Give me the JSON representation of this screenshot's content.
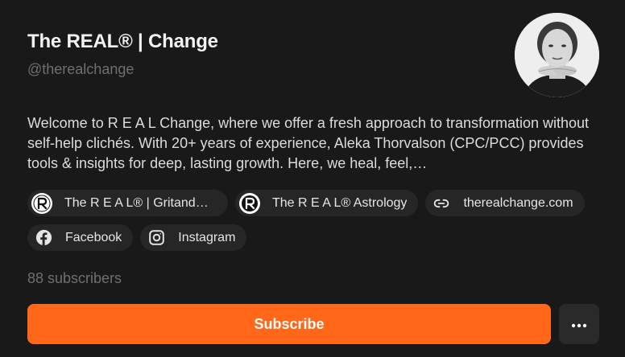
{
  "profile": {
    "title": "The REAL® | Change",
    "handle": "@therealchange",
    "bio": "Welcome to R E A L Change, where we offer a fresh approach to transformation without self-help clichés. With 20+ years of experience, Aleka Thorvalson (CPC/PCC) provides tools & insights for deep, lasting growth. Here, we heal, feel,…"
  },
  "links": [
    {
      "label": "The R E A L® | GritandG…",
      "icon": "real-logo-icon"
    },
    {
      "label": "The R E A L® Astrology",
      "icon": "real-logo-icon"
    },
    {
      "label": "therealchange.com",
      "icon": "link-icon"
    },
    {
      "label": "Facebook",
      "icon": "facebook-icon"
    },
    {
      "label": "Instagram",
      "icon": "instagram-icon"
    }
  ],
  "subscribers_text": "88 subscribers",
  "actions": {
    "subscribe_label": "Subscribe",
    "more_icon": "more-dots-icon"
  },
  "colors": {
    "background": "#191919",
    "accent": "#ff6719",
    "chip": "#262626",
    "muted_text": "#6f6f6f"
  }
}
